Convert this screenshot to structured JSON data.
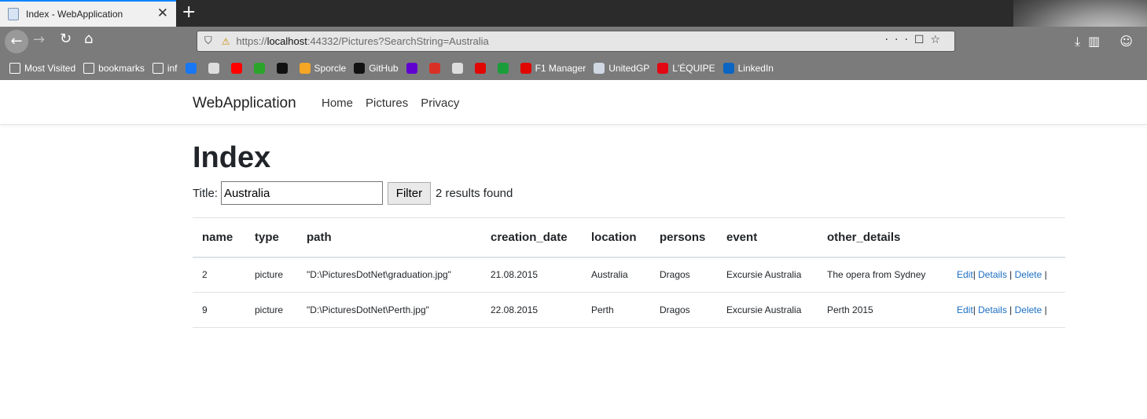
{
  "browser": {
    "tab_title": "Index - WebApplication",
    "url_scheme": "https://",
    "url_host": "localhost",
    "url_rest": ":44332/Pictures?SearchString=Australia",
    "bookmarks": [
      {
        "label": "Most Visited",
        "color": "#ffffff"
      },
      {
        "label": "bookmarks",
        "color": "#ffffff"
      },
      {
        "label": "inf",
        "color": "#ffffff"
      },
      {
        "label": "",
        "color": "#1877f2"
      },
      {
        "label": "",
        "color": "#dddddd"
      },
      {
        "label": "",
        "color": "#ff0000"
      },
      {
        "label": "",
        "color": "#2aa52a"
      },
      {
        "label": "",
        "color": "#111111"
      },
      {
        "label": "Sporcle",
        "color": "#f5a623"
      },
      {
        "label": "GitHub",
        "color": "#111111"
      },
      {
        "label": "",
        "color": "#6001d2"
      },
      {
        "label": "",
        "color": "#d93025"
      },
      {
        "label": "",
        "color": "#dddddd"
      },
      {
        "label": "",
        "color": "#e10600"
      },
      {
        "label": "",
        "color": "#1a9e3a"
      },
      {
        "label": "F1 Manager",
        "color": "#e10600"
      },
      {
        "label": "UnitedGP",
        "color": "#cfd8e3"
      },
      {
        "label": "L'ÉQUIPE",
        "color": "#e30613"
      },
      {
        "label": "LinkedIn",
        "color": "#0a66c2"
      }
    ]
  },
  "site": {
    "brand": "WebApplication",
    "nav": [
      "Home",
      "Pictures",
      "Privacy"
    ]
  },
  "page": {
    "heading": "Index",
    "filter_label": "Title:",
    "filter_value": "Australia",
    "filter_button": "Filter",
    "results_text": "2 results found"
  },
  "table": {
    "columns": [
      "name",
      "type",
      "path",
      "creation_date",
      "location",
      "persons",
      "event",
      "other_details",
      ""
    ],
    "rows": [
      {
        "name": "2",
        "type": "picture",
        "path": "\"D:\\PicturesDotNet\\graduation.jpg\"",
        "creation_date": "21.08.2015",
        "location": "Australia",
        "persons": "Dragos",
        "event": "Excursie Australia",
        "other_details": "The opera from Sydney"
      },
      {
        "name": "9",
        "type": "picture",
        "path": "\"D:\\PicturesDotNet\\Perth.jpg\"",
        "creation_date": "22.08.2015",
        "location": "Perth",
        "persons": "Dragos",
        "event": "Excursie Australia",
        "other_details": "Perth 2015"
      }
    ],
    "actions": {
      "edit": "Edit",
      "details": "Details",
      "delete": "Delete"
    }
  }
}
